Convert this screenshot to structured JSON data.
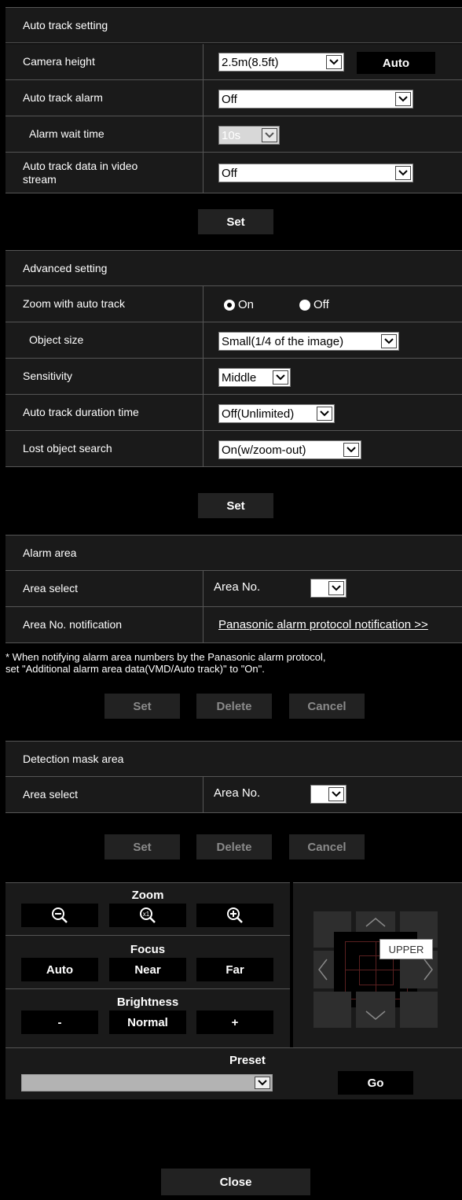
{
  "auto_track": {
    "header": "Auto track setting",
    "camera_height": {
      "label": "Camera height",
      "value": "2.5m(8.5ft)",
      "auto_button": "Auto"
    },
    "alarm": {
      "label": "Auto track alarm",
      "value": "Off"
    },
    "alarm_wait": {
      "label": "Alarm wait time",
      "value": "10s"
    },
    "data_in_stream": {
      "label_line1": "Auto track data in video",
      "label_line2": "stream",
      "value": "Off"
    },
    "set_button": "Set"
  },
  "advanced": {
    "header": "Advanced setting",
    "zoom_with_auto_track": {
      "label": "Zoom with auto track",
      "on": "On",
      "off": "Off",
      "selected": "On"
    },
    "object_size": {
      "label": "Object size",
      "value": "Small(1/4 of the image)"
    },
    "sensitivity": {
      "label": "Sensitivity",
      "value": "Middle"
    },
    "duration": {
      "label": "Auto track duration time",
      "value": "Off(Unlimited)"
    },
    "lost_search": {
      "label": "Lost object search",
      "value": "On(w/zoom-out)"
    },
    "set_button": "Set"
  },
  "alarm_area": {
    "header": "Alarm area",
    "area_select": {
      "label": "Area select",
      "area_no_label": "Area No.",
      "value": ""
    },
    "notification": {
      "label": "Area No. notification",
      "link": "Panasonic alarm protocol notification >>"
    },
    "note_line1": "* When notifying alarm area numbers by the Panasonic alarm protocol,",
    "note_line2": "set \"Additional alarm area data(VMD/Auto track)\" to \"On\".",
    "buttons": {
      "set": "Set",
      "delete": "Delete",
      "cancel": "Cancel"
    }
  },
  "mask_area": {
    "header": "Detection mask area",
    "area_select": {
      "label": "Area select",
      "area_no_label": "Area No.",
      "value": ""
    },
    "buttons": {
      "set": "Set",
      "delete": "Delete",
      "cancel": "Cancel"
    }
  },
  "controls": {
    "zoom": {
      "title": "Zoom",
      "icons": [
        "zoom-out-icon",
        "zoom-x1-icon",
        "zoom-in-icon"
      ]
    },
    "focus": {
      "title": "Focus",
      "auto": "Auto",
      "near": "Near",
      "far": "Far"
    },
    "brightness": {
      "title": "Brightness",
      "minus": "-",
      "normal": "Normal",
      "plus": "+"
    },
    "pad_tooltip": "UPPER",
    "preset": {
      "title": "Preset",
      "value": "",
      "go": "Go"
    }
  },
  "close_button": "Close"
}
